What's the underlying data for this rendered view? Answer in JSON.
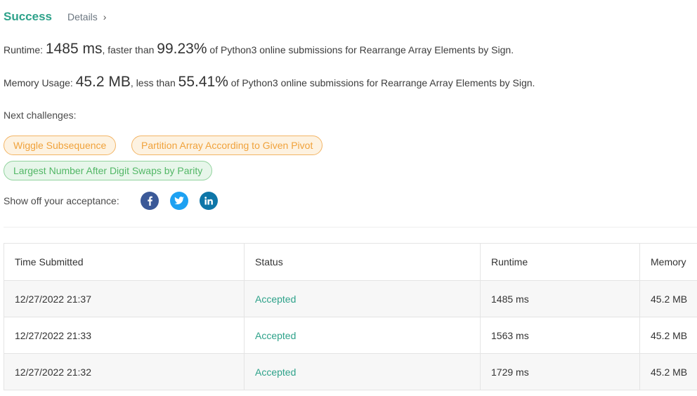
{
  "header": {
    "status": "Success",
    "details_label": "Details",
    "details_chevron": "›"
  },
  "runtime": {
    "label": "Runtime:",
    "value": "1485 ms",
    "comparison": ", faster than",
    "percent": "99.23%",
    "suffix": "of Python3 online submissions for Rearrange Array Elements by Sign."
  },
  "memory": {
    "label": "Memory Usage:",
    "value": "45.2 MB",
    "comparison": ", less than",
    "percent": "55.41%",
    "suffix": "of Python3 online submissions for Rearrange Array Elements by Sign."
  },
  "next_challenges": {
    "label": "Next challenges:",
    "items": [
      {
        "title": "Wiggle Subsequence",
        "difficulty": "medium"
      },
      {
        "title": "Partition Array According to Given Pivot",
        "difficulty": "medium"
      },
      {
        "title": "Largest Number After Digit Swaps by Parity",
        "difficulty": "easy"
      }
    ]
  },
  "share": {
    "label": "Show off your acceptance:",
    "icons": [
      "facebook-icon",
      "twitter-icon",
      "linkedin-icon"
    ]
  },
  "colors": {
    "success": "#2ea28a",
    "medium_pill_text": "#f0a23b",
    "easy_pill_text": "#52b766",
    "facebook": "#3b5998",
    "twitter": "#1da1f2",
    "linkedin": "#0e76a8"
  },
  "table": {
    "headers": [
      "Time Submitted",
      "Status",
      "Runtime",
      "Memory"
    ],
    "rows": [
      {
        "time": "12/27/2022 21:37",
        "status": "Accepted",
        "runtime": "1485 ms",
        "memory": "45.2 MB"
      },
      {
        "time": "12/27/2022 21:33",
        "status": "Accepted",
        "runtime": "1563 ms",
        "memory": "45.2 MB"
      },
      {
        "time": "12/27/2022 21:32",
        "status": "Accepted",
        "runtime": "1729 ms",
        "memory": "45.2 MB"
      }
    ]
  }
}
